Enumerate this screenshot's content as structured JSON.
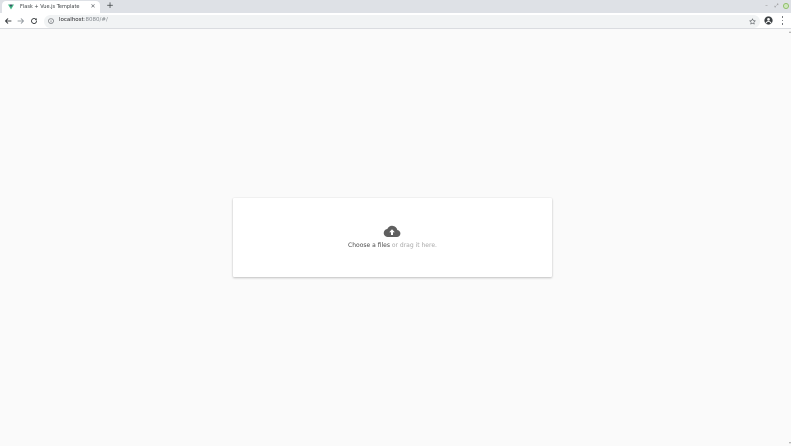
{
  "browser": {
    "tab": {
      "title": "Flask + Vue.js Template",
      "close_glyph": "✕",
      "favicon": "vue-logo"
    },
    "new_tab_glyph": "+",
    "window_controls": {
      "minimize": "–",
      "restore": "⤢",
      "status_color": "#8fbf6a"
    },
    "address": {
      "host": "localhost",
      "rest": ":8080/#/"
    },
    "icons": [
      "back-arrow-icon",
      "forward-arrow-icon",
      "reload-icon",
      "info-icon",
      "star-icon",
      "profile-icon",
      "menu-kebab-icon"
    ]
  },
  "upload": {
    "icon": "cloud-upload-icon",
    "choose_label": "Choose a files",
    "hint": " or drag it here."
  },
  "colors": {
    "page_background": "#fafafa",
    "card_background": "#ffffff",
    "icon_gray": "#5f6368",
    "hint_text": "#a8a8a8",
    "vue_green": "#41b883"
  }
}
